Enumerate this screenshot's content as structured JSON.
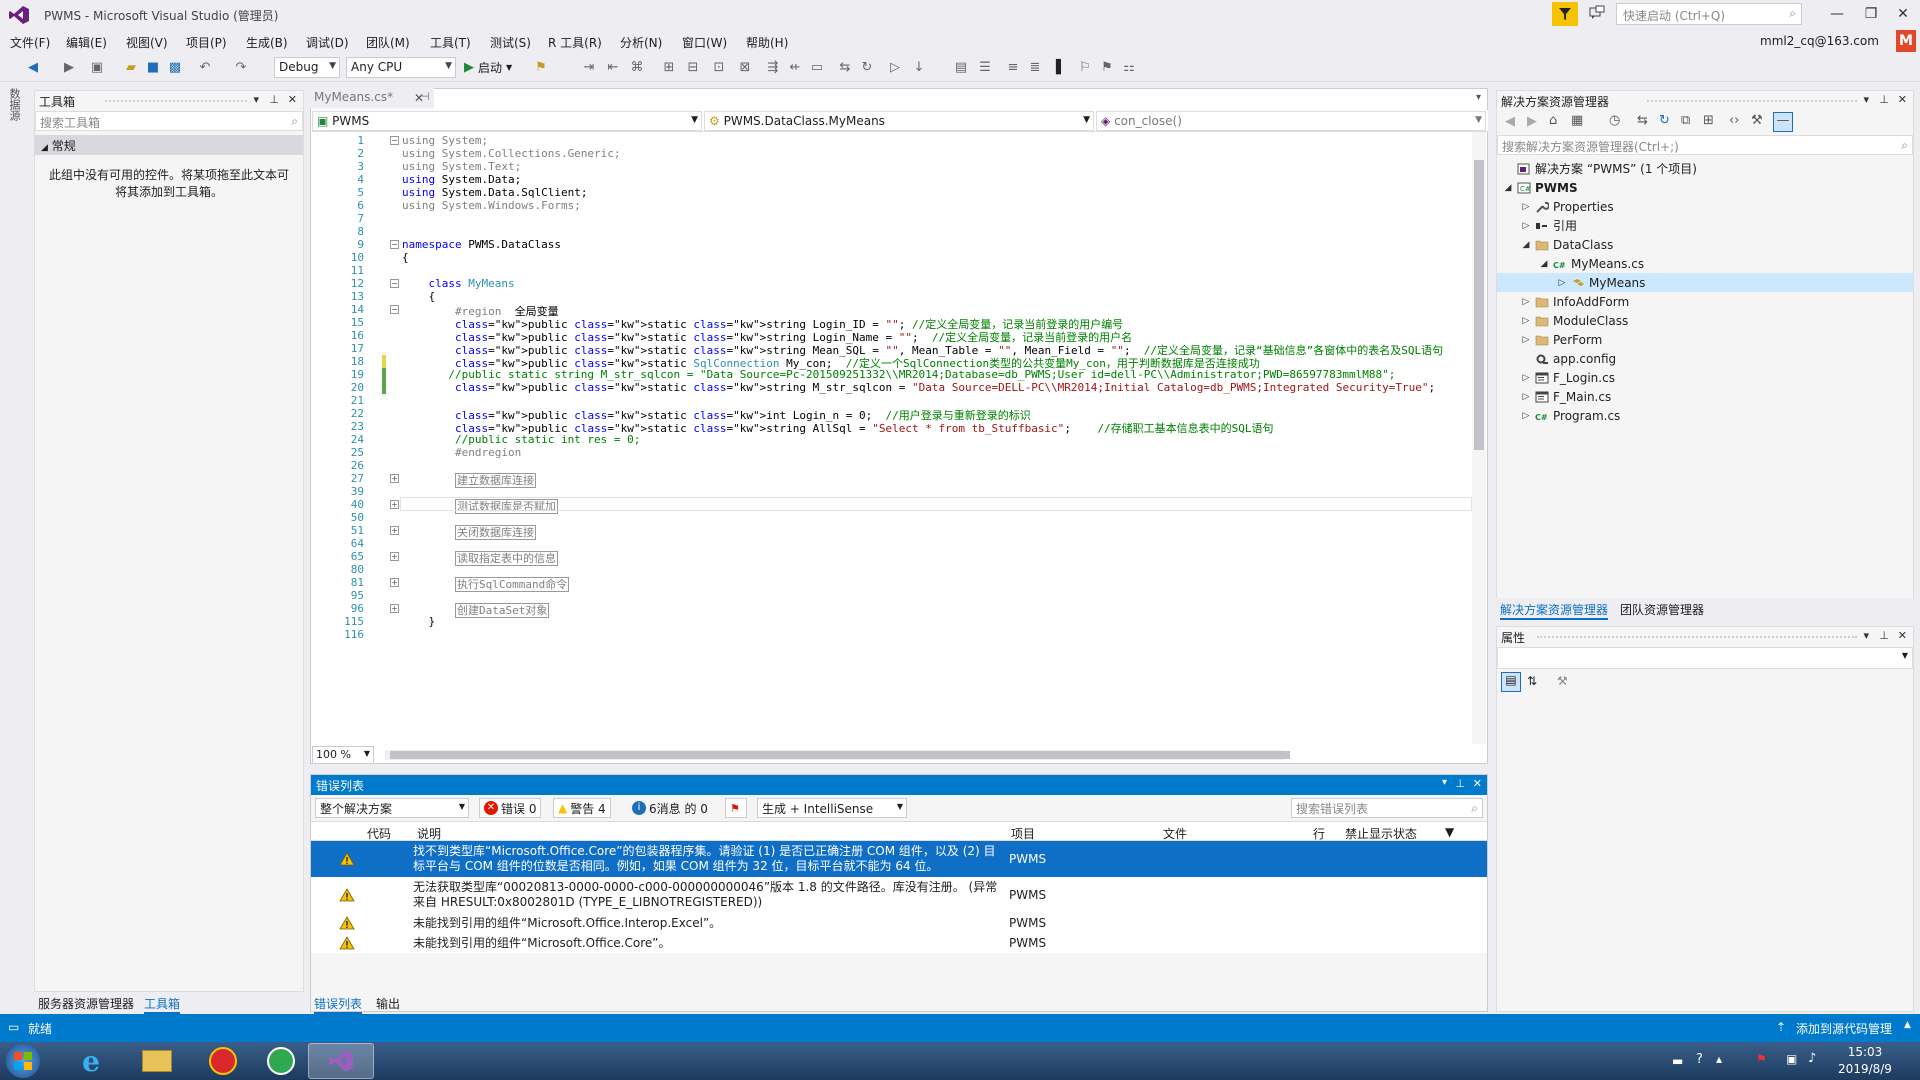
{
  "window": {
    "title": "PWMS - Microsoft Visual Studio (管理员)",
    "quick_launch_placeholder": "快速启动 (Ctrl+Q)",
    "account": "mml2_cq@163.com",
    "avatar_letter": "M"
  },
  "menu": [
    "文件(F)",
    "编辑(E)",
    "视图(V)",
    "项目(P)",
    "生成(B)",
    "调试(D)",
    "团队(M)",
    "工具(T)",
    "测试(S)",
    "R 工具(R)",
    "分析(N)",
    "窗口(W)",
    "帮助(H)"
  ],
  "toolbar": {
    "config": "Debug",
    "platform": "Any CPU",
    "start": "启动"
  },
  "left_strip": {
    "label": "数据源"
  },
  "toolbox": {
    "title": "工具箱",
    "search_placeholder": "搜索工具箱",
    "group": "常规",
    "empty_text": "此组中没有可用的控件。将某项拖至此文本可将其添加到工具箱。",
    "bottom_tabs": [
      "服务器资源管理器",
      "工具箱"
    ]
  },
  "editor": {
    "tab": "MyMeans.cs*",
    "nav": {
      "project": "PWMS",
      "class": "PWMS.DataClass.MyMeans",
      "member": "con_close()"
    },
    "zoom": "100 %",
    "lines": [
      {
        "n": "1",
        "t": "using System;",
        "k": "gray"
      },
      {
        "n": "2",
        "t": "using System.Collections.Generic;",
        "k": "gray"
      },
      {
        "n": "3",
        "t": "using System.Text;",
        "k": "gray"
      },
      {
        "n": "4",
        "t": "using System.Data;",
        "k": "using"
      },
      {
        "n": "5",
        "t": "using System.Data.SqlClient;",
        "k": "using"
      },
      {
        "n": "6",
        "t": "using System.Windows.Forms;",
        "k": "gray"
      },
      {
        "n": "7",
        "t": "",
        "k": "plain"
      },
      {
        "n": "8",
        "t": "",
        "k": "plain"
      },
      {
        "n": "9",
        "t": "namespace PWMS.DataClass",
        "k": "ns"
      },
      {
        "n": "10",
        "t": "{",
        "k": "plain"
      },
      {
        "n": "11",
        "t": "",
        "k": "plain"
      },
      {
        "n": "12",
        "t": "    class MyMeans",
        "k": "cls"
      },
      {
        "n": "13",
        "t": "    {",
        "k": "plain"
      },
      {
        "n": "14",
        "t": "        #region  全局变量",
        "k": "region"
      },
      {
        "n": "15",
        "t": "        public static string Login_ID = \"\"; //定义全局变量，记录当前登录的用户编号",
        "k": "pub"
      },
      {
        "n": "16",
        "t": "        public static string Login_Name = \"\";  //定义全局变量，记录当前登录的用户名",
        "k": "pub"
      },
      {
        "n": "17",
        "t": "        public static string Mean_SQL = \"\", Mean_Table = \"\", Mean_Field = \"\";  //定义全局变量，记录“基础信息”各窗体中的表名及SQL语句",
        "k": "pub"
      },
      {
        "n": "18",
        "t": "        public static SqlConnection My_con;  //定义一个SqlConnection类型的公共变量My_con，用于判断数据库是否连接成功",
        "k": "pub"
      },
      {
        "n": "19",
        "t": "       //public static string M_str_sqlcon = \"Data Source=Pc-201509251332\\\\MR2014;Database=db_PWMS;User id=dell-PC\\\\Administrator;PWD=86597783mmlM88\";",
        "k": "cmt"
      },
      {
        "n": "20",
        "t": "        public static string M_str_sqlcon = \"Data Source=DELL-PC\\\\MR2014;Initial Catalog=db_PWMS;Integrated Security=True\";",
        "k": "pub"
      },
      {
        "n": "21",
        "t": "",
        "k": "plain"
      },
      {
        "n": "22",
        "t": "        public static int Login_n = 0;  //用户登录与重新登录的标识",
        "k": "pub"
      },
      {
        "n": "23",
        "t": "        public static string AllSql = \"Select * from tb_Stuffbasic\";    //存储职工基本信息表中的SQL语句",
        "k": "pub"
      },
      {
        "n": "24",
        "t": "        //public static int res = 0;",
        "k": "cmt"
      },
      {
        "n": "25",
        "t": "        #endregion",
        "k": "region"
      },
      {
        "n": "26",
        "t": "",
        "k": "plain"
      },
      {
        "n": "27",
        "t": "建立数据库连接",
        "k": "coll"
      },
      {
        "n": "39",
        "t": "",
        "k": "plain"
      },
      {
        "n": "40",
        "t": "测试数据库是否赋加",
        "k": "coll"
      },
      {
        "n": "50",
        "t": "",
        "k": "plain"
      },
      {
        "n": "51",
        "t": "关闭数据库连接",
        "k": "coll"
      },
      {
        "n": "64",
        "t": "",
        "k": "plain"
      },
      {
        "n": "65",
        "t": "读取指定表中的信息",
        "k": "coll"
      },
      {
        "n": "80",
        "t": "",
        "k": "plain"
      },
      {
        "n": "81",
        "t": "执行SqlCommand命令",
        "k": "coll"
      },
      {
        "n": "95",
        "t": "",
        "k": "plain"
      },
      {
        "n": "96",
        "t": "创建DataSet对象",
        "k": "coll"
      },
      {
        "n": "115",
        "t": "    }",
        "k": "plain"
      },
      {
        "n": "116",
        "t": "",
        "k": "plain"
      }
    ]
  },
  "errors": {
    "title": "错误列表",
    "scope": "整个解决方案",
    "errors_btn": "错误 0",
    "warnings_btn": "警告 4",
    "messages_btn": "6消息 的 0",
    "build_filter": "生成 + IntelliSense",
    "search_placeholder": "搜索错误列表",
    "columns": [
      "代码",
      "说明",
      "项目",
      "文件",
      "行",
      "禁止显示状态"
    ],
    "rows": [
      {
        "desc": "找不到类型库“Microsoft.Office.Core”的包装器程序集。请验证 (1) 是否已正确注册 COM 组件，以及 (2) 目标平台与 COM 组件的位数是否相同。例如，如果 COM 组件为 32 位，目标平台就不能为 64 位。",
        "project": "PWMS"
      },
      {
        "desc": "无法获取类型库“00020813-0000-0000-c000-000000000046”版本 1.8 的文件路径。库没有注册。 (异常来自 HRESULT:0x8002801D (TYPE_E_LIBNOTREGISTERED))",
        "project": "PWMS"
      },
      {
        "desc": "未能找到引用的组件“Microsoft.Office.Interop.Excel”。",
        "project": "PWMS"
      },
      {
        "desc": "未能找到引用的组件“Microsoft.Office.Core”。",
        "project": "PWMS"
      }
    ],
    "bottom_tabs": [
      "错误列表",
      "输出"
    ]
  },
  "solution": {
    "title": "解决方案资源管理器",
    "search_placeholder": "搜索解决方案资源管理器(Ctrl+;)",
    "tree": [
      {
        "label": "解决方案 “PWMS” (1 个项目)",
        "depth": 0,
        "tri": "",
        "icon": "sln"
      },
      {
        "label": "PWMS",
        "depth": 0,
        "tri": "◢",
        "icon": "cs",
        "bold": true
      },
      {
        "label": "Properties",
        "depth": 1,
        "tri": "▷",
        "icon": "wrench"
      },
      {
        "label": "引用",
        "depth": 1,
        "tri": "▷",
        "icon": "ref"
      },
      {
        "label": "DataClass",
        "depth": 1,
        "tri": "◢",
        "icon": "folder"
      },
      {
        "label": "MyMeans.cs",
        "depth": 2,
        "tri": "◢",
        "icon": "csfile"
      },
      {
        "label": "MyMeans",
        "depth": 3,
        "tri": "▷",
        "icon": "class",
        "selected": true
      },
      {
        "label": "InfoAddForm",
        "depth": 1,
        "tri": "▷",
        "icon": "folder"
      },
      {
        "label": "ModuleClass",
        "depth": 1,
        "tri": "▷",
        "icon": "folder"
      },
      {
        "label": "PerForm",
        "depth": 1,
        "tri": "▷",
        "icon": "folder"
      },
      {
        "label": "app.config",
        "depth": 1,
        "tri": "",
        "icon": "config"
      },
      {
        "label": "F_Login.cs",
        "depth": 1,
        "tri": "▷",
        "icon": "form"
      },
      {
        "label": "F_Main.cs",
        "depth": 1,
        "tri": "▷",
        "icon": "form"
      },
      {
        "label": "Program.cs",
        "depth": 1,
        "tri": "▷",
        "icon": "csfile"
      }
    ],
    "bottom_tabs": [
      "解决方案资源管理器",
      "团队资源管理器"
    ]
  },
  "properties": {
    "title": "属性"
  },
  "status": {
    "text": "就绪",
    "right": "添加到源代码管理"
  },
  "taskbar": {
    "time": "15:03",
    "date": "2019/8/9"
  },
  "colors": {
    "accent": "#007acc",
    "vs_purple": "#68217a",
    "selection": "#0f6fc6",
    "warning": "#f5c400"
  }
}
